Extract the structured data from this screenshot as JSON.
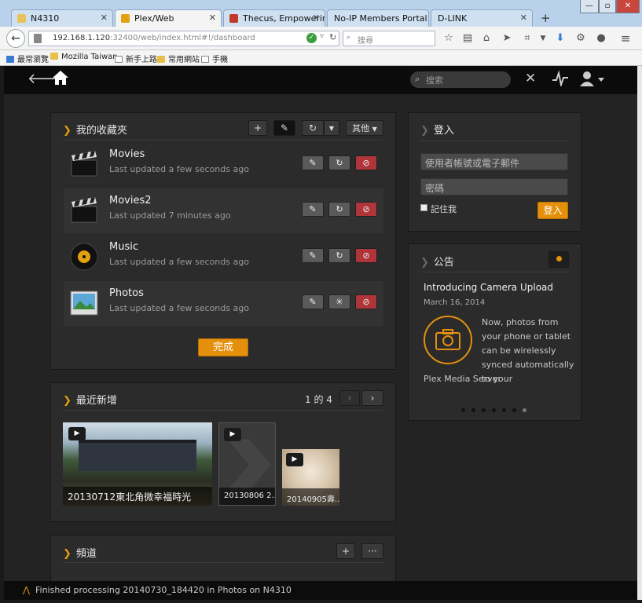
{
  "browser": {
    "tabs": [
      {
        "label": "N4310",
        "fav": "#e8c25a"
      },
      {
        "label": "Plex/Web",
        "fav": "#e5a00d"
      },
      {
        "label": "Thecus, Empowerin...",
        "fav": "#c0392b"
      },
      {
        "label": "No-IP Members Portal: ...",
        "fav": "#cfe0f1"
      },
      {
        "label": "D-LINK",
        "fav": "#cfe0f1"
      }
    ],
    "new_tab": "+",
    "url_host": "192.168.1.120",
    "url_rest": ":32400/web/index.html#!/dashboard",
    "search_placeholder": "搜尋",
    "bookmarks": [
      "最常瀏覽",
      "Mozilla Taiwan",
      "新手上路",
      "常用網站",
      "手機"
    ]
  },
  "plex": {
    "search_placeholder": "搜索",
    "library": {
      "title": "我的收藏夾",
      "more_label": "其他",
      "done_label": "完成",
      "items": [
        {
          "name": "Movies",
          "updated": "Last updated a few seconds ago",
          "icon": "clapper-icon"
        },
        {
          "name": "Movies2",
          "updated": "Last updated 7 minutes ago",
          "icon": "clapper-icon"
        },
        {
          "name": "Music",
          "updated": "Last updated a few seconds ago",
          "icon": "vinyl-icon"
        },
        {
          "name": "Photos",
          "updated": "Last updated a few seconds ago",
          "icon": "photo-icon"
        }
      ]
    },
    "recent": {
      "title": "最近新增",
      "page": "1 的 4",
      "items": [
        {
          "caption": "20130712東北角微幸福時光"
        },
        {
          "caption": "20130806 2..."
        },
        {
          "caption": "20140905壽..."
        }
      ]
    },
    "channels": {
      "title": "頻道",
      "more_label": "···"
    },
    "login": {
      "title": "登入",
      "user_placeholder": "使用者帳號或電子郵件",
      "pass_placeholder": "密碼",
      "remember_label": "記住我",
      "submit_label": "登入"
    },
    "news": {
      "title": "公告",
      "headline": "Introducing Camera Upload",
      "date": "March 16, 2014",
      "body": "Now, photos from your phone or tablet can be wirelessly synced automatically to your",
      "tail": "Plex Media Server",
      "dots": 7
    },
    "status": "Finished processing 20140730_184420 in Photos on N4310"
  },
  "colors": {
    "accent": "#e5a00d",
    "danger": "#b0353a"
  }
}
